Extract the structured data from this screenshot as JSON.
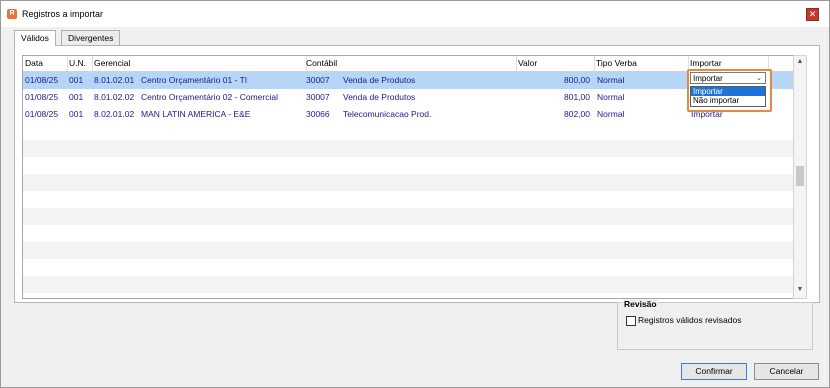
{
  "window": {
    "title": "Registros a importar",
    "close_glyph": "✕",
    "app_icon_glyph": "R"
  },
  "tabs": [
    {
      "label": "Válidos",
      "active": true
    },
    {
      "label": "Divergentes",
      "active": false
    }
  ],
  "grid": {
    "columns": [
      "Data",
      "U.N.",
      "Gerencial",
      "",
      "Contábil",
      "",
      "Valor",
      "Tipo Verba",
      "Importar"
    ],
    "rows": [
      {
        "data": "01/08/25",
        "un": "001",
        "ger_code": "8.01.02.01",
        "ger_desc": "Centro Orçamentário 01 - TI",
        "cont_code": "30007",
        "cont_desc": "Venda de Produtos",
        "valor": "800,00",
        "tipo": "Normal",
        "importar": "Importar",
        "selected": true
      },
      {
        "data": "01/08/25",
        "un": "001",
        "ger_code": "8.01.02.02",
        "ger_desc": "Centro Orçamentário 02 - Comercial",
        "cont_code": "30007",
        "cont_desc": "Venda de Produtos",
        "valor": "801,00",
        "tipo": "Normal",
        "importar": "",
        "selected": false
      },
      {
        "data": "01/08/25",
        "un": "001",
        "ger_code": "8.02.01.02",
        "ger_desc": "MAN LATIN AMERICA - E&E",
        "cont_code": "30066",
        "cont_desc": "Telecomunicacao Prod.",
        "valor": "802,00",
        "tipo": "Normal",
        "importar": "Importar",
        "selected": false
      }
    ]
  },
  "importar_dropdown": {
    "value": "Importar",
    "options": [
      "Importar",
      "Não importar"
    ],
    "highlighted": "Importar"
  },
  "revisao": {
    "title": "Revisão",
    "checkbox_label": "Registros válidos revisados",
    "checked": false
  },
  "buttons": {
    "confirm": "Confirmar",
    "cancel": "Cancelar"
  },
  "scroll": {
    "up": "▲",
    "down": "▼"
  },
  "colors": {
    "selected_row": "#b6d6f7",
    "cell_text": "#1a1a8c",
    "dropdown_highlight": "#e58a3a",
    "option_highlight": "#1e73d8"
  }
}
